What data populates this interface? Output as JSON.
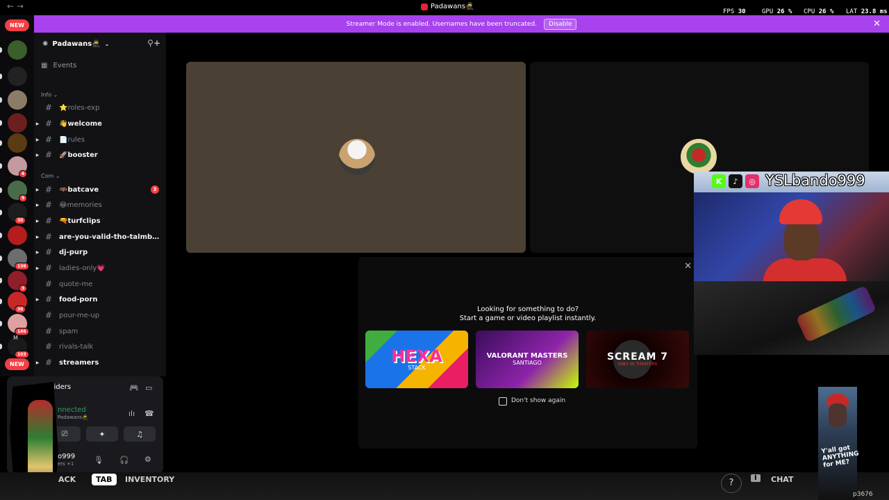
{
  "titlebar": {
    "title": "Padawans🥷",
    "back": "←",
    "forward": "→",
    "window_controls": "—  ☐  ✕"
  },
  "perf": {
    "fps_label": "FPS",
    "fps_value": "30",
    "gpu_label": "GPU",
    "gpu_value": "26 %",
    "cpu_label": "CPU",
    "cpu_value": "26 %",
    "lat_label": "LAT",
    "lat_value": "23.8 ms"
  },
  "rail": {
    "new_top": "NEW",
    "new_bottom": "NEW",
    "servers": [
      {
        "color": "#3a5f2a",
        "badge": ""
      },
      {
        "color": "#222222",
        "badge": ""
      },
      {
        "color": "#8c7b67",
        "badge": ""
      },
      {
        "color": "#6b1f1f",
        "badge": ""
      },
      {
        "color": "#5a3b12",
        "badge": ""
      },
      {
        "color": "#c49aa0",
        "badge": "4"
      },
      {
        "color": "#4a6b4a",
        "badge": "9"
      },
      {
        "color": "#1d1d1d",
        "badge": "30"
      },
      {
        "color": "#b71c1c",
        "badge": ""
      },
      {
        "color": "#6d6d6d",
        "badge": "136"
      },
      {
        "color": "#8e1f2b",
        "badge": "3"
      },
      {
        "color": "#c62828",
        "badge": "36"
      },
      {
        "color": "#e0a0a0",
        "badge": "146"
      },
      {
        "color": "#1a1a1a",
        "badge": "103"
      },
      {
        "color": "#2b2b2b",
        "badge": ""
      }
    ],
    "last_label": "M"
  },
  "banner": {
    "text": "Streamer Mode is enabled. Usernames have been truncated.",
    "disable_label": "Disable"
  },
  "sidebar": {
    "server_name": "Padawans🥷",
    "events_label": "Events",
    "cat_info": "Info",
    "cat_com": "Com",
    "channels": [
      {
        "name": "⭐roles-exp",
        "unread": false,
        "count": "",
        "arrow": ""
      },
      {
        "name": "👋welcome",
        "unread": true,
        "count": "",
        "arrow": "▶"
      },
      {
        "name": "📄rules",
        "unread": false,
        "count": "",
        "arrow": "▶"
      },
      {
        "name": "🚀booster",
        "unread": true,
        "count": "",
        "arrow": "▶"
      },
      {
        "name": "🦇batcave",
        "unread": true,
        "count": "3",
        "arrow": "▶"
      },
      {
        "name": "😂memories",
        "unread": false,
        "count": "",
        "arrow": "▶"
      },
      {
        "name": "🔫turfclips",
        "unread": true,
        "count": "",
        "arrow": "▶"
      },
      {
        "name": "are-you-valid-tho-talmbout-...",
        "unread": true,
        "count": "",
        "arrow": "▶"
      },
      {
        "name": "dj-purp",
        "unread": true,
        "count": "",
        "arrow": "▶"
      },
      {
        "name": "ladies-only💗",
        "unread": false,
        "count": "",
        "arrow": "▶"
      },
      {
        "name": "quote-me",
        "unread": false,
        "count": "",
        "arrow": ""
      },
      {
        "name": "food-porn",
        "unread": true,
        "count": "",
        "arrow": "▶"
      },
      {
        "name": "pour-me-up",
        "unread": false,
        "count": "",
        "arrow": ""
      },
      {
        "name": "spam",
        "unread": false,
        "count": "",
        "arrow": ""
      },
      {
        "name": "rivals-talk",
        "unread": false,
        "count": "",
        "arrow": ""
      },
      {
        "name": "streamers",
        "unread": true,
        "count": "",
        "arrow": "▶"
      }
    ]
  },
  "voice_panel": {
    "activity": "RC Raiders",
    "status": "nnected",
    "channel": "Padawans🥷",
    "screenshare_icon": "⎚",
    "activities_icon": "✦",
    "soundboard_icon": "♫",
    "username": "o999",
    "user_sub": "ers +1"
  },
  "hud": {
    "back": "ACK",
    "tab_key": "TAB",
    "inventory": "INVENTORY",
    "help": "?",
    "i_key": "I",
    "chat": "CHAT"
  },
  "popup": {
    "heading": "Looking for something to do?",
    "subheading": "Start a game or video playlist instantly.",
    "games": [
      {
        "name": "HEXA",
        "sub": "STACK"
      },
      {
        "name": "VALORANT MASTERS",
        "sub": "SANTIAGO"
      },
      {
        "name": "SCREAM 7",
        "sub": "ONLY IN THEATERS"
      }
    ],
    "dont_show": "Don't show again"
  },
  "overlay": {
    "handle": "YSLbando999",
    "socials": [
      {
        "letter": "K",
        "color": "#53fc18"
      },
      {
        "letter": "♪",
        "color": "#111111"
      },
      {
        "letter": "◎",
        "color": "#e1306c"
      }
    ]
  },
  "minicam": {
    "caption": "Y'all got ANYTHING for ME?"
  },
  "watermark": "p3676"
}
